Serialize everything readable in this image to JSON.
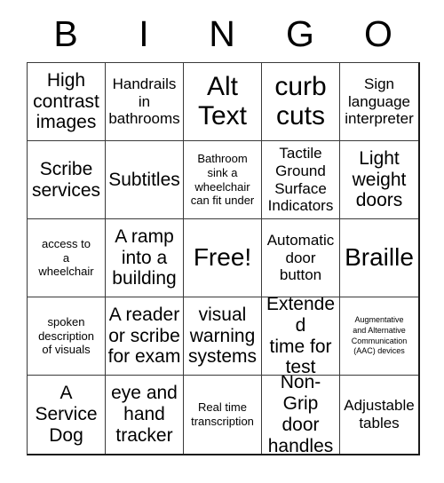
{
  "card": {
    "title": "BINGO",
    "header_letters": [
      "B",
      "I",
      "N",
      "G",
      "O"
    ],
    "rows": [
      [
        {
          "text": "High\ncontrast\nimages",
          "size": "lg"
        },
        {
          "text": "Handrails\nin\nbathrooms",
          "size": "md"
        },
        {
          "text": "Alt\nText",
          "size": "xxl"
        },
        {
          "text": "curb\ncuts",
          "size": "xxl"
        },
        {
          "text": "Sign\nlanguage\ninterpreter",
          "size": "md"
        }
      ],
      [
        {
          "text": "Scribe\nservices",
          "size": "lg"
        },
        {
          "text": "Subtitles",
          "size": "lg"
        },
        {
          "text": "Bathroom\nsink a\nwheelchair\ncan fit under",
          "size": "sm"
        },
        {
          "text": "Tactile\nGround\nSurface\nIndicators",
          "size": "md"
        },
        {
          "text": "Light\nweight\ndoors",
          "size": "lg"
        }
      ],
      [
        {
          "text": "access to\na\nwheelchair",
          "size": "sm"
        },
        {
          "text": "A ramp\ninto a\nbuilding",
          "size": "lg"
        },
        {
          "text": "Free!",
          "size": "xl"
        },
        {
          "text": "Automatic\ndoor\nbutton",
          "size": "md"
        },
        {
          "text": "Braille",
          "size": "xl"
        }
      ],
      [
        {
          "text": "spoken\ndescription\nof visuals",
          "size": "sm"
        },
        {
          "text": "A reader\nor scribe\nfor exam",
          "size": "lg"
        },
        {
          "text": "visual\nwarning\nsystems",
          "size": "lg"
        },
        {
          "text": "Extended\ntime for\ntest",
          "size": "lg"
        },
        {
          "text": "Augmentative\nand Alternative\nCommunication\n(AAC) devices",
          "size": "xxs"
        }
      ],
      [
        {
          "text": "A\nService\nDog",
          "size": "lg"
        },
        {
          "text": "eye and\nhand\ntracker",
          "size": "lg"
        },
        {
          "text": "Real time\ntranscription",
          "size": "sm"
        },
        {
          "text": "Non-Grip\ndoor\nhandles",
          "size": "lg"
        },
        {
          "text": "Adjustable\ntables",
          "size": "md"
        }
      ]
    ]
  },
  "colors": {
    "background": "#ffffff",
    "text": "#000000",
    "grid_line": "#3a3a3a",
    "grid_outer": "#1a1a1a"
  }
}
